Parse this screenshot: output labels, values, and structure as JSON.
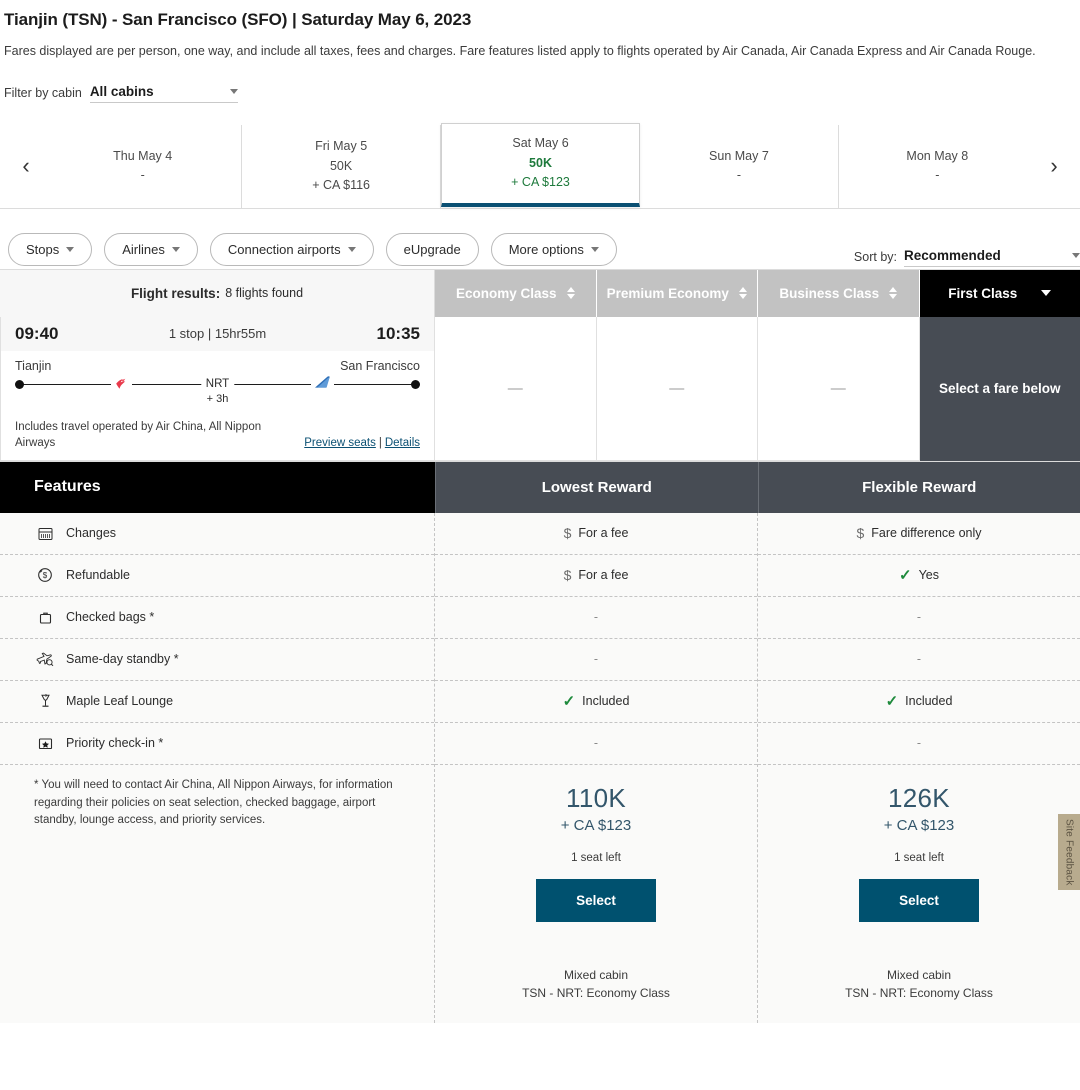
{
  "header": {
    "title": "Tianjin (TSN) - San Francisco (SFO)  |  Saturday May 6, 2023",
    "disclaimer": "Fares displayed are per person, one way, and include all taxes, fees and charges. Fare features listed apply to flights operated by Air Canada, Air Canada Express and Air Canada Rouge."
  },
  "cabin_filter": {
    "label": "Filter by cabin",
    "value": "All cabins"
  },
  "date_carousel": {
    "prev_arrow": "‹",
    "next_arrow": "›",
    "days": [
      {
        "dow": "Thu May 4",
        "points": "-",
        "cash": "",
        "selected": false
      },
      {
        "dow": "Fri May 5",
        "points": "50K",
        "cash": "+ CA $116",
        "selected": false
      },
      {
        "dow": "Sat May 6",
        "points": "50K",
        "cash": "+ CA $123",
        "selected": true
      },
      {
        "dow": "Sun May 7",
        "points": "-",
        "cash": "",
        "selected": false
      },
      {
        "dow": "Mon May 8",
        "points": "-",
        "cash": "",
        "selected": false
      }
    ]
  },
  "filters": {
    "pills": [
      {
        "label": "Stops",
        "caret": true
      },
      {
        "label": "Airlines",
        "caret": true
      },
      {
        "label": "Connection airports",
        "caret": true
      },
      {
        "label": "eUpgrade",
        "caret": false
      },
      {
        "label": "More options",
        "caret": true
      }
    ],
    "sort": {
      "label": "Sort by:",
      "value": "Recommended"
    }
  },
  "results_header": {
    "label": "Flight results:",
    "count": "8 flights found",
    "cabin_tabs": [
      {
        "label": "Economy Class",
        "active": false,
        "sortable": true
      },
      {
        "label": "Premium Economy",
        "active": false,
        "sortable": true
      },
      {
        "label": "Business Class",
        "active": false,
        "sortable": true
      },
      {
        "label": "First Class",
        "active": true,
        "sortable": false
      }
    ]
  },
  "flight": {
    "depart_time": "09:40",
    "summary": "1 stop | 15hr55m",
    "arrive_time": "10:35",
    "origin_city": "Tianjin",
    "destination_city": "San Francisco",
    "stop_code": "NRT",
    "layover": "+ 3h",
    "operated_note": "Includes travel operated by Air China, All Nippon Airways",
    "preview_seats_link": "Preview seats",
    "link_separator": "|",
    "details_link": "Details",
    "fare_cells": [
      "—",
      "—",
      "—"
    ],
    "selected_cell_text": "Select a fare below"
  },
  "features_table": {
    "title": "Features",
    "columns": [
      "Lowest Reward",
      "Flexible Reward"
    ],
    "rows": [
      {
        "icon": "calendar-icon",
        "label": "Changes",
        "lowest": {
          "icon": "dollar",
          "text": "For a fee"
        },
        "flexible": {
          "icon": "dollar",
          "text": "Fare difference only"
        }
      },
      {
        "icon": "refund-dollar-icon",
        "label": "Refundable",
        "lowest": {
          "icon": "dollar",
          "text": "For a fee"
        },
        "flexible": {
          "icon": "check",
          "text": "Yes"
        }
      },
      {
        "icon": "suitcase-icon",
        "label": "Checked bags *",
        "lowest": {
          "icon": "none",
          "text": "-"
        },
        "flexible": {
          "icon": "none",
          "text": "-"
        }
      },
      {
        "icon": "standby-plane-icon",
        "label": "Same-day standby *",
        "lowest": {
          "icon": "none",
          "text": "-"
        },
        "flexible": {
          "icon": "none",
          "text": "-"
        }
      },
      {
        "icon": "lounge-glass-icon",
        "label": "Maple Leaf Lounge",
        "lowest": {
          "icon": "check",
          "text": "Included"
        },
        "flexible": {
          "icon": "check",
          "text": "Included"
        }
      },
      {
        "icon": "priority-star-icon",
        "label": "Priority check-in *",
        "lowest": {
          "icon": "none",
          "text": "-"
        },
        "flexible": {
          "icon": "none",
          "text": "-"
        }
      }
    ],
    "footnote": "* You will need to contact Air China, All Nippon Airways, for information regarding their policies on seat selection, checked baggage, airport standby, lounge access, and priority services.",
    "prices": [
      {
        "points": "110K",
        "cash": "+ CA $123",
        "seats": "1 seat left",
        "button": "Select",
        "mixed_title": "Mixed cabin",
        "mixed_detail": "TSN - NRT: Economy Class"
      },
      {
        "points": "126K",
        "cash": "+ CA $123",
        "seats": "1 seat left",
        "button": "Select",
        "mixed_title": "Mixed cabin",
        "mixed_detail": "TSN - NRT: Economy Class"
      }
    ]
  },
  "feedback_tab": {
    "label": "Site Feedback"
  },
  "colors": {
    "accent_blue": "#00516f",
    "selected_tab_underline": "#0b5073",
    "green": "#1e8a3c",
    "dark_header": "#474c54",
    "price_blue": "#33566b"
  }
}
